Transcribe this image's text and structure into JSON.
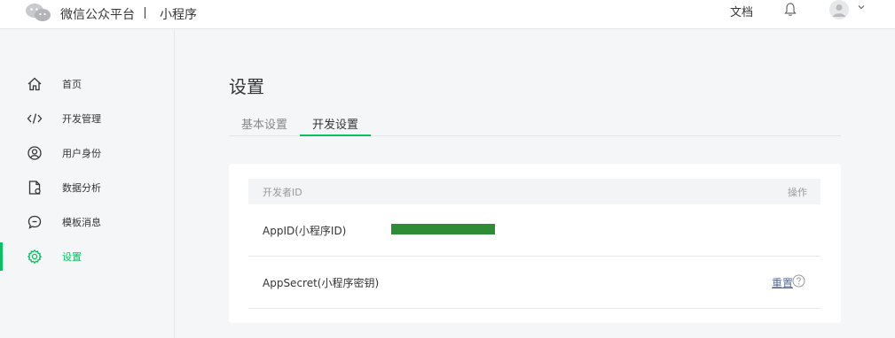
{
  "header": {
    "brand": "微信公众平台",
    "separator": "|",
    "product": "小程序",
    "doc_link": "文档"
  },
  "sidebar": {
    "items": [
      {
        "label": "首页",
        "icon": "home-icon"
      },
      {
        "label": "开发管理",
        "icon": "code-icon"
      },
      {
        "label": "用户身份",
        "icon": "user-circle-icon"
      },
      {
        "label": "数据分析",
        "icon": "data-file-icon"
      },
      {
        "label": "模板消息",
        "icon": "message-icon"
      },
      {
        "label": "设置",
        "icon": "gear-icon",
        "active": true
      }
    ]
  },
  "main": {
    "title": "设置",
    "tabs": [
      {
        "label": "基本设置",
        "active": false
      },
      {
        "label": "开发设置",
        "active": true
      }
    ],
    "table": {
      "header_left": "开发者ID",
      "header_right": "操作",
      "rows": [
        {
          "label": "AppID(小程序ID)",
          "value_masked": true
        },
        {
          "label": "AppSecret(小程序密钥)",
          "action": "重置"
        }
      ]
    }
  },
  "colors": {
    "accent": "#07c160",
    "link": "#576b95",
    "masked": "#2e8b36",
    "background": "#f5f6f7"
  }
}
